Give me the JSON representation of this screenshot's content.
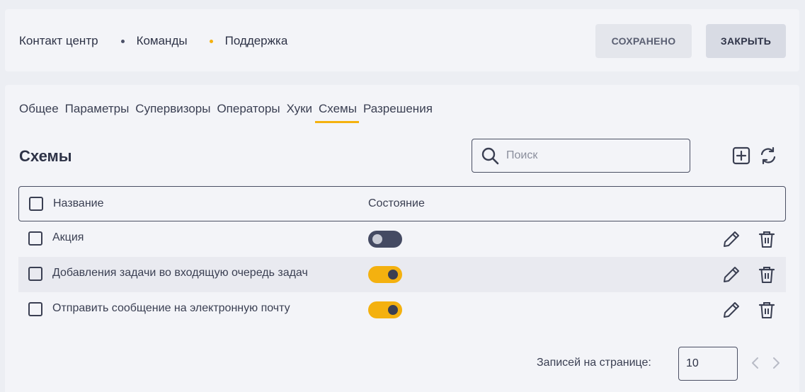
{
  "breadcrumb": [
    "Контакт центр",
    "Команды",
    "Поддержка"
  ],
  "header": {
    "saved_label": "СОХРАНЕНО",
    "close_label": "ЗАКРЫТЬ"
  },
  "tabs": [
    {
      "label": "Общее",
      "active": false
    },
    {
      "label": "Параметры",
      "active": false
    },
    {
      "label": "Супервизоры",
      "active": false
    },
    {
      "label": "Операторы",
      "active": false
    },
    {
      "label": "Хуки",
      "active": false
    },
    {
      "label": "Схемы",
      "active": true
    },
    {
      "label": "Разрешения",
      "active": false
    }
  ],
  "section": {
    "title": "Схемы"
  },
  "search": {
    "placeholder": "Поиск",
    "value": ""
  },
  "table": {
    "columns": [
      "Название",
      "Состояние"
    ],
    "rows": [
      {
        "name": "Акция",
        "enabled": false
      },
      {
        "name": "Добавления задачи во входящую очередь задач",
        "enabled": true
      },
      {
        "name": "Отправить сообщение на электронную почту",
        "enabled": true
      }
    ]
  },
  "pagination": {
    "label": "Записей на странице:",
    "per_page": "10"
  },
  "colors": {
    "accent": "#f4b10f",
    "text": "#2e3347",
    "toggle_off": "#444a62"
  },
  "icons": [
    "search-icon",
    "add-icon",
    "refresh-icon",
    "edit-icon",
    "delete-icon",
    "chevron-left-icon",
    "chevron-right-icon"
  ]
}
